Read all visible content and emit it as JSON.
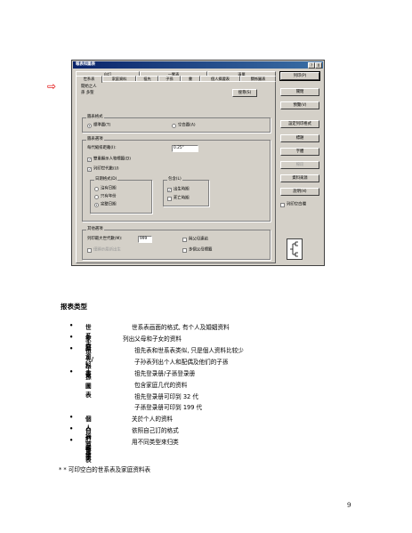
{
  "dialog": {
    "title": "報表和圖表",
    "title_buttons": [
      "?",
      "X"
    ],
    "tabs_top": [
      {
        "label": "自訂"
      },
      {
        "label": "一覽表"
      },
      {
        "label": "清單"
      }
    ],
    "tabs_bottom": [
      {
        "label": "世系表",
        "active": true
      },
      {
        "label": "家庭資料"
      },
      {
        "label": "祖先"
      },
      {
        "label": "子孫"
      },
      {
        "label": "書"
      },
      {
        "label": "個人摘要表"
      },
      {
        "label": "關係圖表"
      }
    ],
    "person_heading": "開始之人",
    "person_name": "孫 多聖",
    "search_button": "搜尋(S)",
    "format_group": {
      "legend": "圖表格式",
      "options": [
        {
          "label": "標準圖(T)",
          "selected": true
        },
        {
          "label": "空白圖(A)",
          "selected": false
        }
      ]
    },
    "options_group": {
      "legend": "圖表選項",
      "indent_label": "每代縮排距離(I):",
      "indent_value": "0.25\"",
      "checkboxes": [
        {
          "label": "雙重顯示人物標籤(D)",
          "checked": true
        },
        {
          "label": "列印世代數(U)",
          "checked": true
        }
      ]
    },
    "date_group": {
      "legend": "日期格式(D)",
      "options": [
        {
          "label": "沒有日期",
          "selected": false
        },
        {
          "label": "只有年份",
          "selected": false
        },
        {
          "label": "完整日期",
          "selected": true
        }
      ]
    },
    "include_group": {
      "legend": "包含(L)",
      "checkboxes": [
        {
          "label": "出生時期",
          "checked": true
        },
        {
          "label": "死亡時期",
          "checked": false
        }
      ]
    },
    "other_group": {
      "legend": "其他選項",
      "max_gen_label": "列印最大世代數(M):",
      "max_gen_value": "999",
      "checkboxes": [
        {
          "label": "與父母連結",
          "checked": false,
          "disabled": false
        },
        {
          "label": "多個父母標籤",
          "checked": false,
          "disabled": false
        },
        {
          "label": "僅顯示最新出生",
          "checked": false,
          "disabled": true
        }
      ]
    },
    "side_buttons": [
      {
        "label": "列印(P)",
        "default": true,
        "disabled": false
      },
      {
        "label": "關閉",
        "default": false,
        "disabled": false
      },
      {
        "label": "預覽(V)",
        "default": false,
        "disabled": false
      },
      {
        "label": "設定列印格式",
        "default": false,
        "disabled": false
      },
      {
        "label": "標題",
        "default": false,
        "disabled": false
      },
      {
        "label": "字體",
        "default": false,
        "disabled": false
      },
      {
        "label": "線段",
        "default": false,
        "disabled": true
      },
      {
        "label": "資料來源",
        "default": false,
        "disabled": false
      },
      {
        "label": "說明(H)",
        "default": false,
        "disabled": false
      }
    ],
    "print_blank_label": "列印空白欄",
    "print_blank_checked": false,
    "icons": {
      "arrow": "red-arrow-icon",
      "pedigree": "pedigree-chart-icon"
    }
  },
  "doc": {
    "heading": "报表类型",
    "bullet": "•",
    "items": [
      {
        "term": "世系表",
        "desc": [
          "世系表画面的格式, 有个人及婚姻资料"
        ]
      },
      {
        "term": "家庭资料表",
        "desc": [
          "列出父母和子女的资料"
        ]
      },
      {
        "term": "祖先/子孫圖表",
        "desc": [
          "祖先表和世系表类似, 只是個人资料比较少",
          "子孙表列出个人和配偶及他们的子孫"
        ]
      },
      {
        "term": "書",
        "desc": [
          "祖先登录册/子孫登录册",
          "包含家庭几代的资料",
          "祖先登录册可印到 32 代",
          "子孫登录册可印到 199 代"
        ]
      },
      {
        "term": "個人摘要表",
        "desc": [
          "关於个人的资料"
        ]
      },
      {
        "term": "自訂報表",
        "desc": [
          "依照自己訂的格式"
        ]
      },
      {
        "term": "一覽表",
        "desc": [
          "用不同类型來归类"
        ]
      }
    ],
    "note": "* *  可印空白的世系表及家庭资料表",
    "page_number": "9"
  }
}
